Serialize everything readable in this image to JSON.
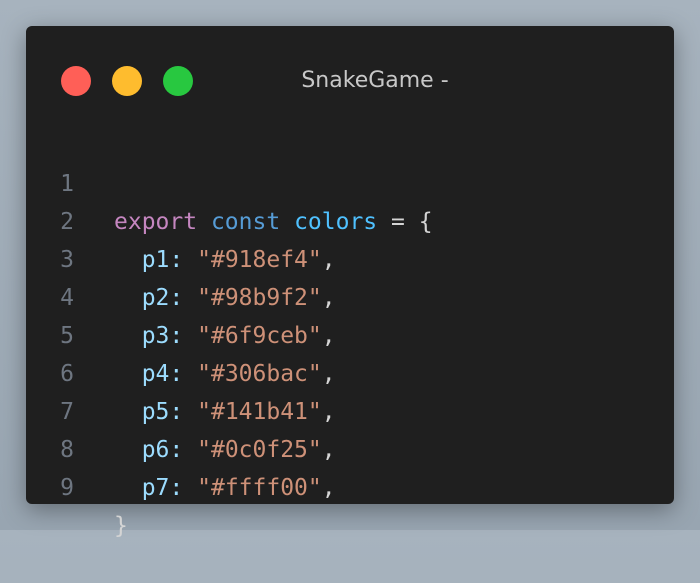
{
  "window": {
    "title": "SnakeGame -"
  },
  "traffic_lights": [
    {
      "name": "close",
      "color": "#ff5f57"
    },
    {
      "name": "minimize",
      "color": "#febc2e"
    },
    {
      "name": "maximize",
      "color": "#28c840"
    }
  ],
  "code": {
    "line_numbers": [
      "1",
      "2",
      "3",
      "4",
      "5",
      "6",
      "7",
      "8",
      "9"
    ],
    "line1": {
      "export": "export",
      "const": "const",
      "name": "colors",
      "rest": " = {"
    },
    "entries": [
      {
        "key": "p1",
        "value": "\"#918ef4\""
      },
      {
        "key": "p2",
        "value": "\"#98b9f2\""
      },
      {
        "key": "p3",
        "value": "\"#6f9ceb\""
      },
      {
        "key": "p4",
        "value": "\"#306bac\""
      },
      {
        "key": "p5",
        "value": "\"#141b41\""
      },
      {
        "key": "p6",
        "value": "\"#0c0f25\""
      },
      {
        "key": "p7",
        "value": "\"#ffff00\""
      }
    ],
    "colon": ":",
    "comma": ",",
    "closing": "}"
  },
  "theme": {
    "keyword_export": "#c586c0",
    "keyword_const": "#569cd6",
    "variable": "#4fc1ff",
    "property": "#9cdcfe",
    "string": "#ce9178",
    "line_number": "#6e7681",
    "background": "#1f1f1f"
  }
}
